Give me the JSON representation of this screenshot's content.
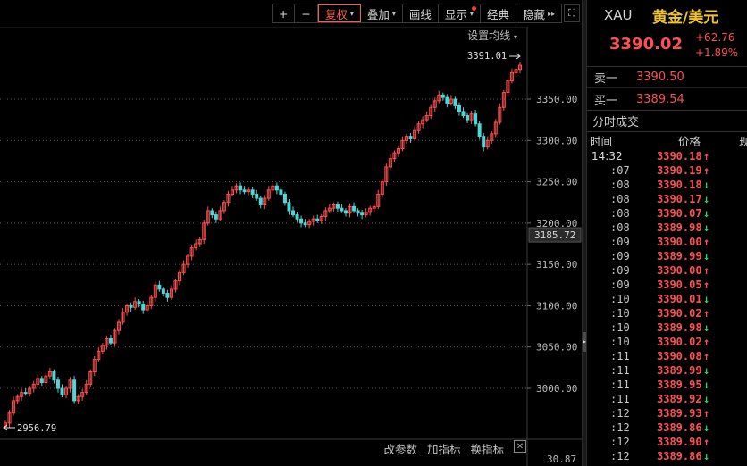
{
  "toolbar": {
    "plus": "+",
    "minus": "−",
    "items": [
      {
        "label": "复权",
        "caret": "▾",
        "active": true
      },
      {
        "label": "叠加",
        "caret": "▾"
      },
      {
        "label": "画线"
      },
      {
        "label": "显示",
        "caret": "▾",
        "dot": true
      },
      {
        "label": "经典"
      },
      {
        "label": "隐藏",
        "caret": "▸▸"
      }
    ],
    "fullscreen": "⛶"
  },
  "chart": {
    "ma_setting": "设置均线",
    "ma_caret": "▾",
    "bottom_tools": [
      "改参数",
      "加指标",
      "换指标"
    ],
    "bottom_close": "✕",
    "max_label": "3391.01",
    "min_label": "2956.79",
    "current_price": "3185.72",
    "bottom_value": "30.87"
  },
  "chart_data": {
    "type": "candlestick",
    "y_ticks": [
      "3350.00",
      "3300.00",
      "3250.00",
      "3200.00",
      "3150.00",
      "3100.00",
      "3050.00",
      "3000.00"
    ],
    "ylim": [
      2950,
      3400
    ],
    "close": [
      2958,
      2970,
      2985,
      2990,
      2995,
      2994,
      3000,
      3005,
      3012,
      3007,
      3015,
      3020,
      3010,
      3000,
      2992,
      3000,
      3010,
      2985,
      2990,
      2995,
      3005,
      3020,
      3035,
      3045,
      3052,
      3060,
      3055,
      3070,
      3080,
      3092,
      3100,
      3098,
      3105,
      3102,
      3095,
      3100,
      3110,
      3125,
      3120,
      3115,
      3110,
      3120,
      3130,
      3140,
      3150,
      3160,
      3170,
      3175,
      3180,
      3200,
      3215,
      3210,
      3205,
      3215,
      3225,
      3235,
      3240,
      3245,
      3240,
      3238,
      3240,
      3235,
      3230,
      3222,
      3230,
      3240,
      3245,
      3240,
      3235,
      3225,
      3215,
      3210,
      3205,
      3200,
      3198,
      3202,
      3205,
      3203,
      3208,
      3215,
      3218,
      3222,
      3218,
      3215,
      3212,
      3220,
      3215,
      3212,
      3210,
      3213,
      3218,
      3220,
      3235,
      3250,
      3268,
      3278,
      3285,
      3290,
      3300,
      3305,
      3302,
      3312,
      3320,
      3325,
      3330,
      3340,
      3348,
      3355,
      3352,
      3345,
      3350,
      3342,
      3335,
      3330,
      3325,
      3332,
      3320,
      3305,
      3292,
      3300,
      3308,
      3322,
      3340,
      3358,
      3372,
      3382,
      3386,
      3391
    ]
  },
  "quote": {
    "symbol": "XAU",
    "name": "黄金/美元",
    "last": "3390.02",
    "change": "+62.76",
    "change_pct": "+1.89%",
    "sell_label": "卖一",
    "sell_price": "3390.50",
    "buy_label": "买一",
    "buy_price": "3389.54",
    "ticks_title": "分时成交",
    "col_time": "时间",
    "col_price": "价格",
    "col_vol": "现",
    "ticks": [
      {
        "time": "14:32",
        "price": "3390.18",
        "dir": "up"
      },
      {
        "time": ":07",
        "price": "3390.19",
        "dir": "up"
      },
      {
        "time": ":08",
        "price": "3390.18",
        "dir": "down"
      },
      {
        "time": ":08",
        "price": "3390.17",
        "dir": "down"
      },
      {
        "time": ":08",
        "price": "3390.07",
        "dir": "down"
      },
      {
        "time": ":08",
        "price": "3389.98",
        "dir": "down"
      },
      {
        "time": ":09",
        "price": "3390.00",
        "dir": "up"
      },
      {
        "time": ":09",
        "price": "3389.99",
        "dir": "down"
      },
      {
        "time": ":09",
        "price": "3390.00",
        "dir": "up"
      },
      {
        "time": ":09",
        "price": "3390.05",
        "dir": "up"
      },
      {
        "time": ":10",
        "price": "3390.01",
        "dir": "down"
      },
      {
        "time": ":10",
        "price": "3390.02",
        "dir": "up"
      },
      {
        "time": ":10",
        "price": "3389.98",
        "dir": "down"
      },
      {
        "time": ":10",
        "price": "3390.02",
        "dir": "up"
      },
      {
        "time": ":11",
        "price": "3390.08",
        "dir": "up"
      },
      {
        "time": ":11",
        "price": "3389.99",
        "dir": "down"
      },
      {
        "time": ":11",
        "price": "3389.95",
        "dir": "down"
      },
      {
        "time": ":11",
        "price": "3389.92",
        "dir": "down"
      },
      {
        "time": ":12",
        "price": "3389.93",
        "dir": "up"
      },
      {
        "time": ":12",
        "price": "3389.86",
        "dir": "down"
      },
      {
        "time": ":12",
        "price": "3389.90",
        "dir": "up"
      },
      {
        "time": ":12",
        "price": "3389.86",
        "dir": "down"
      }
    ]
  },
  "colors": {
    "up": "#ff4f4f",
    "down": "#2fd15a",
    "candle_down": "#4fd6d6",
    "grid": "#5a5a5a",
    "gold_name": "#f0c431"
  }
}
